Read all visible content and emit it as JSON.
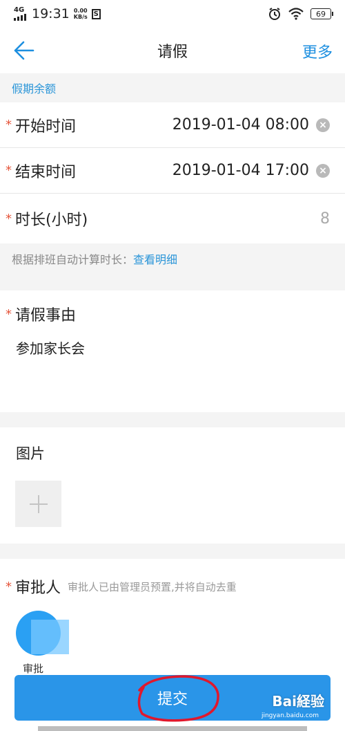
{
  "status_bar": {
    "network": "4G",
    "time": "19:31",
    "speed_value": "0.00",
    "speed_unit": "KB/s",
    "s_icon": "S",
    "battery": "69"
  },
  "nav": {
    "title": "请假",
    "more": "更多"
  },
  "section_label": "假期余额",
  "fields": {
    "start": {
      "label": "开始时间",
      "value": "2019-01-04 08:00",
      "required_mark": "*"
    },
    "end": {
      "label": "结束时间",
      "value": "2019-01-04 17:00",
      "required_mark": "*"
    },
    "duration": {
      "label": "时长(小时)",
      "value": "8",
      "required_mark": "*"
    }
  },
  "hint": {
    "text": "根据排班自动计算时长：",
    "link": "查看明细"
  },
  "reason": {
    "label": "请假事由",
    "value": "参加家长会",
    "required_mark": "*"
  },
  "images": {
    "label": "图片"
  },
  "approver": {
    "label": "审批人",
    "note": "审批人已由管理员预置,并将自动去重",
    "name": "审批",
    "required_mark": "*"
  },
  "submit_label": "提交",
  "watermark": {
    "brand": "Bai経验",
    "url": "jingyan.baidu.com"
  },
  "colors": {
    "accent": "#1d8fe0",
    "submit": "#2a95e8",
    "required": "#e5553b",
    "annotation": "#e0182d"
  }
}
